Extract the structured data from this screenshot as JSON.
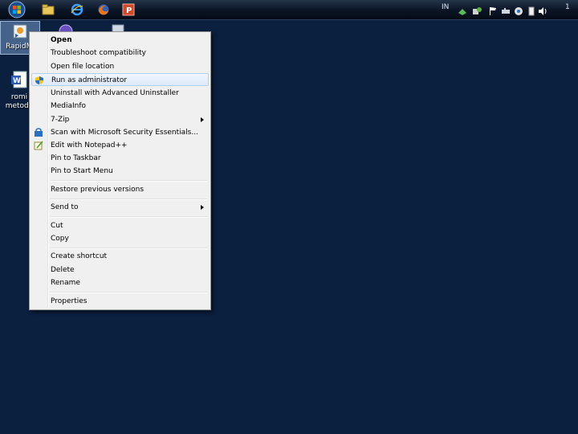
{
  "taskbar": {
    "start_label": "Start",
    "pinned": [
      "explorer-icon",
      "internet-explorer-icon",
      "firefox-icon",
      "powerpoint-icon"
    ],
    "tray": {
      "language": "IN",
      "clock": "1"
    }
  },
  "desktop": {
    "icons": [
      {
        "label": "RapidMi",
        "icon": "rapidminer-icon",
        "selected": true
      },
      {
        "label": "romi",
        "icon": "word-document-icon"
      },
      {
        "label": "metodo",
        "icon": "word-document-icon"
      }
    ]
  },
  "context_menu": {
    "items": [
      {
        "label": "Open",
        "bold": true
      },
      {
        "label": "Troubleshoot compatibility"
      },
      {
        "label": "Open file location"
      },
      {
        "label": "Run as administrator",
        "icon": "uac-shield-icon",
        "highlighted": true
      },
      {
        "label": "Uninstall with Advanced Uninstaller"
      },
      {
        "label": "MediaInfo"
      },
      {
        "label": "7-Zip",
        "submenu": true
      },
      {
        "label": "Scan with Microsoft Security Essentials...",
        "icon": "security-essentials-icon"
      },
      {
        "label": "Edit with Notepad++",
        "icon": "notepad-icon"
      },
      {
        "label": "Pin to Taskbar"
      },
      {
        "label": "Pin to Start Menu"
      },
      {
        "label": "Restore previous versions"
      },
      {
        "label": "Send to",
        "submenu": true
      },
      {
        "label": "Cut"
      },
      {
        "label": "Copy"
      },
      {
        "label": "Create shortcut"
      },
      {
        "label": "Delete"
      },
      {
        "label": "Rename"
      },
      {
        "label": "Properties"
      }
    ]
  },
  "colors": {
    "desktop_bg": "#0b1f3e",
    "menu_bg": "#f0f0f0",
    "highlight_border": "#aecff7"
  }
}
